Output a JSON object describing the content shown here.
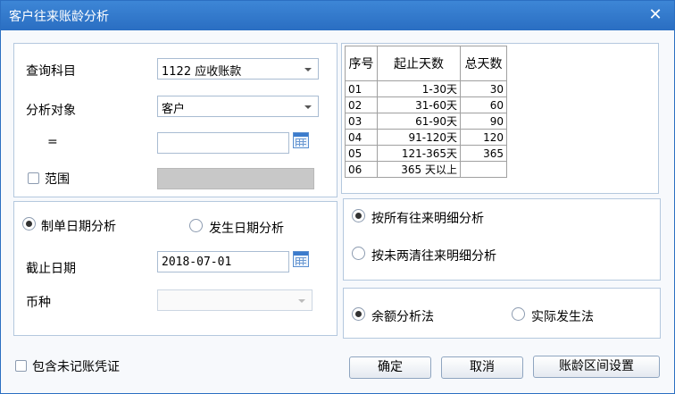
{
  "window": {
    "title": "客户往来账龄分析",
    "close_glyph": "✕"
  },
  "subject": {
    "label": "查询科目",
    "value": "1122 应收账款"
  },
  "target": {
    "label": "分析对象",
    "value": "客户"
  },
  "equals": {
    "label": "=",
    "value": ""
  },
  "range": {
    "label": "范围",
    "checked": false
  },
  "age_table": {
    "headers": [
      "序号",
      "起止天数",
      "总天数"
    ],
    "rows": [
      {
        "no": "01",
        "range": "1-30天",
        "total": "30"
      },
      {
        "no": "02",
        "range": "31-60天",
        "total": "60"
      },
      {
        "no": "03",
        "range": "61-90天",
        "total": "90"
      },
      {
        "no": "04",
        "range": "91-120天",
        "total": "120"
      },
      {
        "no": "05",
        "range": "121-365天",
        "total": "365"
      },
      {
        "no": "06",
        "range": "365 天以上",
        "total": ""
      }
    ]
  },
  "date_mode": {
    "option1": "制单日期分析",
    "option2": "发生日期分析",
    "selected": 1
  },
  "cutoff": {
    "label": "截止日期",
    "value": "2018-07-01"
  },
  "currency": {
    "label": "币种",
    "value": ""
  },
  "detail_mode": {
    "option1": "按所有往来明细分析",
    "option2": "按未两清往来明细分析",
    "selected": 1
  },
  "method": {
    "option1": "余额分析法",
    "option2": "实际发生法",
    "selected": 1
  },
  "include_unposted": {
    "label": "包含未记账凭证",
    "checked": false
  },
  "buttons": {
    "ok": "确定",
    "cancel": "取消",
    "settings": "账龄区间设置"
  }
}
